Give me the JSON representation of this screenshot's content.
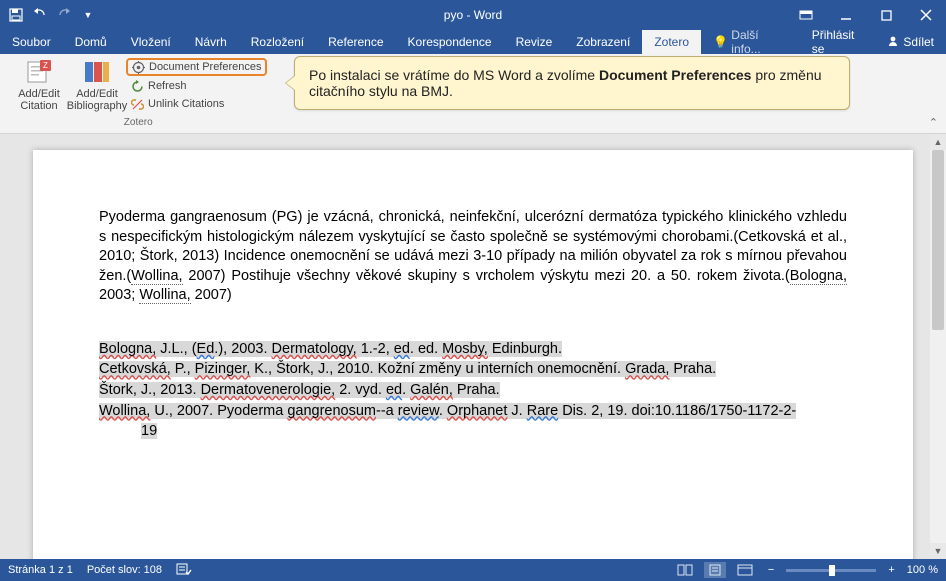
{
  "titlebar": {
    "title": "pyo - Word"
  },
  "tabs": {
    "file": "Soubor",
    "items": [
      "Domů",
      "Vložení",
      "Návrh",
      "Rozložení",
      "Reference",
      "Korespondence",
      "Revize",
      "Zobrazení",
      "Zotero"
    ],
    "active": "Zotero",
    "tell": "Další info...",
    "signin": "Přihlásit se",
    "share": "Sdílet"
  },
  "ribbon": {
    "add_edit_citation": "Add/Edit Citation",
    "add_edit_biblio": "Add/Edit Bibliography",
    "doc_prefs": "Document Preferences",
    "refresh": "Refresh",
    "unlink": "Unlink Citations",
    "group": "Zotero"
  },
  "callout": {
    "pre": "Po instalaci se vrátíme do MS Word a zvolíme ",
    "bold": "Document Preferences",
    "post": " pro změnu citačního stylu na BMJ."
  },
  "doc": {
    "para": "Pyoderma gangraenosum (PG) je vzácná, chronická, neinfekční, ulcerózní dermatóza typického klinického vzhledu s nespecifickým histologickým nálezem vyskytující se často společně se systémovými chorobami.(Cetkovská et al., 2010; Štork, 2013) Incidence onemocnění se udává mezi 3-10 případy na milión obyvatel za rok s mírnou převahou žen.(",
    "wollina1": "Wollina,",
    "para_mid": " 2007) Postihuje všechny věkové skupiny s vrcholem výskytu mezi 20. a 50. rokem života.(",
    "bolognia1": "Bologna,",
    "para_mid2": " 2003; ",
    "wollina2": "Wollina,",
    "para_end": " 2007)",
    "refs": [
      {
        "a": "Bologna,",
        "b": " J.L., (",
        "c": "Ed",
        "d": ".), 2003. ",
        "e": "Dermatology,",
        "f": " 1.-2, ",
        "g": "ed",
        "h": ". ed. ",
        "i": "Mosby,",
        "j": " Edinburgh."
      },
      {
        "a": "Cetkovská,",
        "b": " P., ",
        "c": "Pizinger,",
        "d": " K., Štork, J., 2010. Kožní změny u interních onemocnění. ",
        "e": "Grada,",
        "f": " Praha."
      },
      {
        "a": "Štork,",
        "b": " J., 2013. ",
        "c": "Dermatovenerologie,",
        "d": " 2. vyd. ",
        "e": "ed",
        "f": ". ",
        "g": "Galén,",
        "h": " Praha."
      },
      {
        "a": "Wollina,",
        "b": " U., 2007. Pyoderma ",
        "c": "gangrenosum",
        "d": "--a ",
        "e": "review",
        "f": ". ",
        "g": "Orphanet",
        "h": " J. ",
        "i": "Rare",
        "j": " Dis. 2, 19. doi:10.1186/1750-1172-2-",
        "k": "19"
      }
    ]
  },
  "status": {
    "page": "Stránka 1 z 1",
    "words": "Počet slov: 108",
    "zoom": "100 %"
  }
}
